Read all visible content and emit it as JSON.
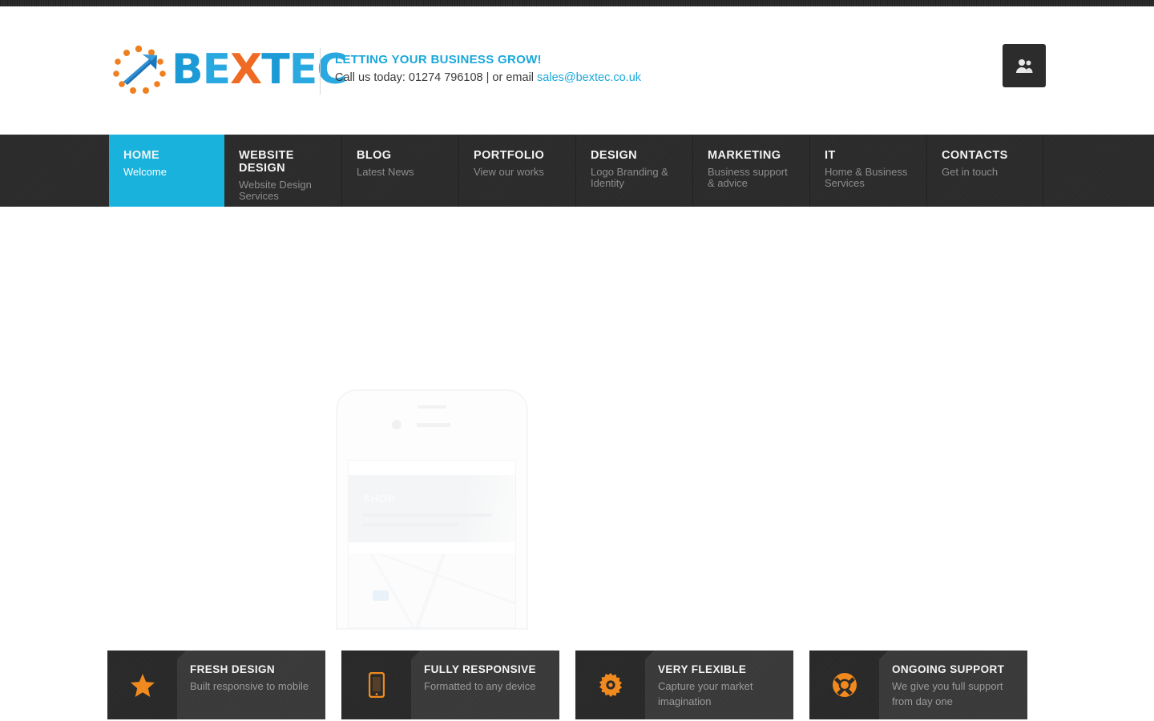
{
  "site": {
    "brand_name": "BEXTEC",
    "brand_letters": [
      "B",
      "E",
      "X",
      "T",
      "E",
      "C"
    ],
    "accent_cyan": "#18b2dd",
    "accent_orange": "#f08a1e",
    "nav_dark": "#2d2d2d"
  },
  "header": {
    "tagline": "LETTING YOUR BUSINESS GROW!",
    "contact_prefix": "Call us today: 01274 796108 | or email ",
    "email": "sales@bextec.co.uk",
    "user_button_icon": "users-icon"
  },
  "nav": {
    "items": [
      {
        "label": "HOME",
        "sub": "Welcome",
        "active": true
      },
      {
        "label": "WEBSITE DESIGN",
        "sub": "Website Design Services",
        "active": false
      },
      {
        "label": "BLOG",
        "sub": "Latest News",
        "active": false
      },
      {
        "label": "PORTFOLIO",
        "sub": "View our works",
        "active": false
      },
      {
        "label": "DESIGN",
        "sub": "Logo Branding & Identity",
        "active": false
      },
      {
        "label": "MARKETING",
        "sub": "Business support & advice",
        "active": false
      },
      {
        "label": "IT",
        "sub": "Home & Business Services",
        "active": false
      },
      {
        "label": "CONTACTS",
        "sub": "Get in touch",
        "active": false
      }
    ]
  },
  "hero": {
    "phone_screen_label": "SHOP"
  },
  "features": [
    {
      "icon": "star-icon",
      "title": "FRESH DESIGN",
      "desc": "Built responsive to mobile"
    },
    {
      "icon": "mobile-phone-icon",
      "title": "FULLY RESPONSIVE",
      "desc": "Formatted to any device"
    },
    {
      "icon": "gear-icon",
      "title": "VERY FLEXIBLE",
      "desc": "Capture your market imagination"
    },
    {
      "icon": "lifebuoy-icon",
      "title": "ONGOING SUPPORT",
      "desc": "We give you full support from day one"
    }
  ]
}
